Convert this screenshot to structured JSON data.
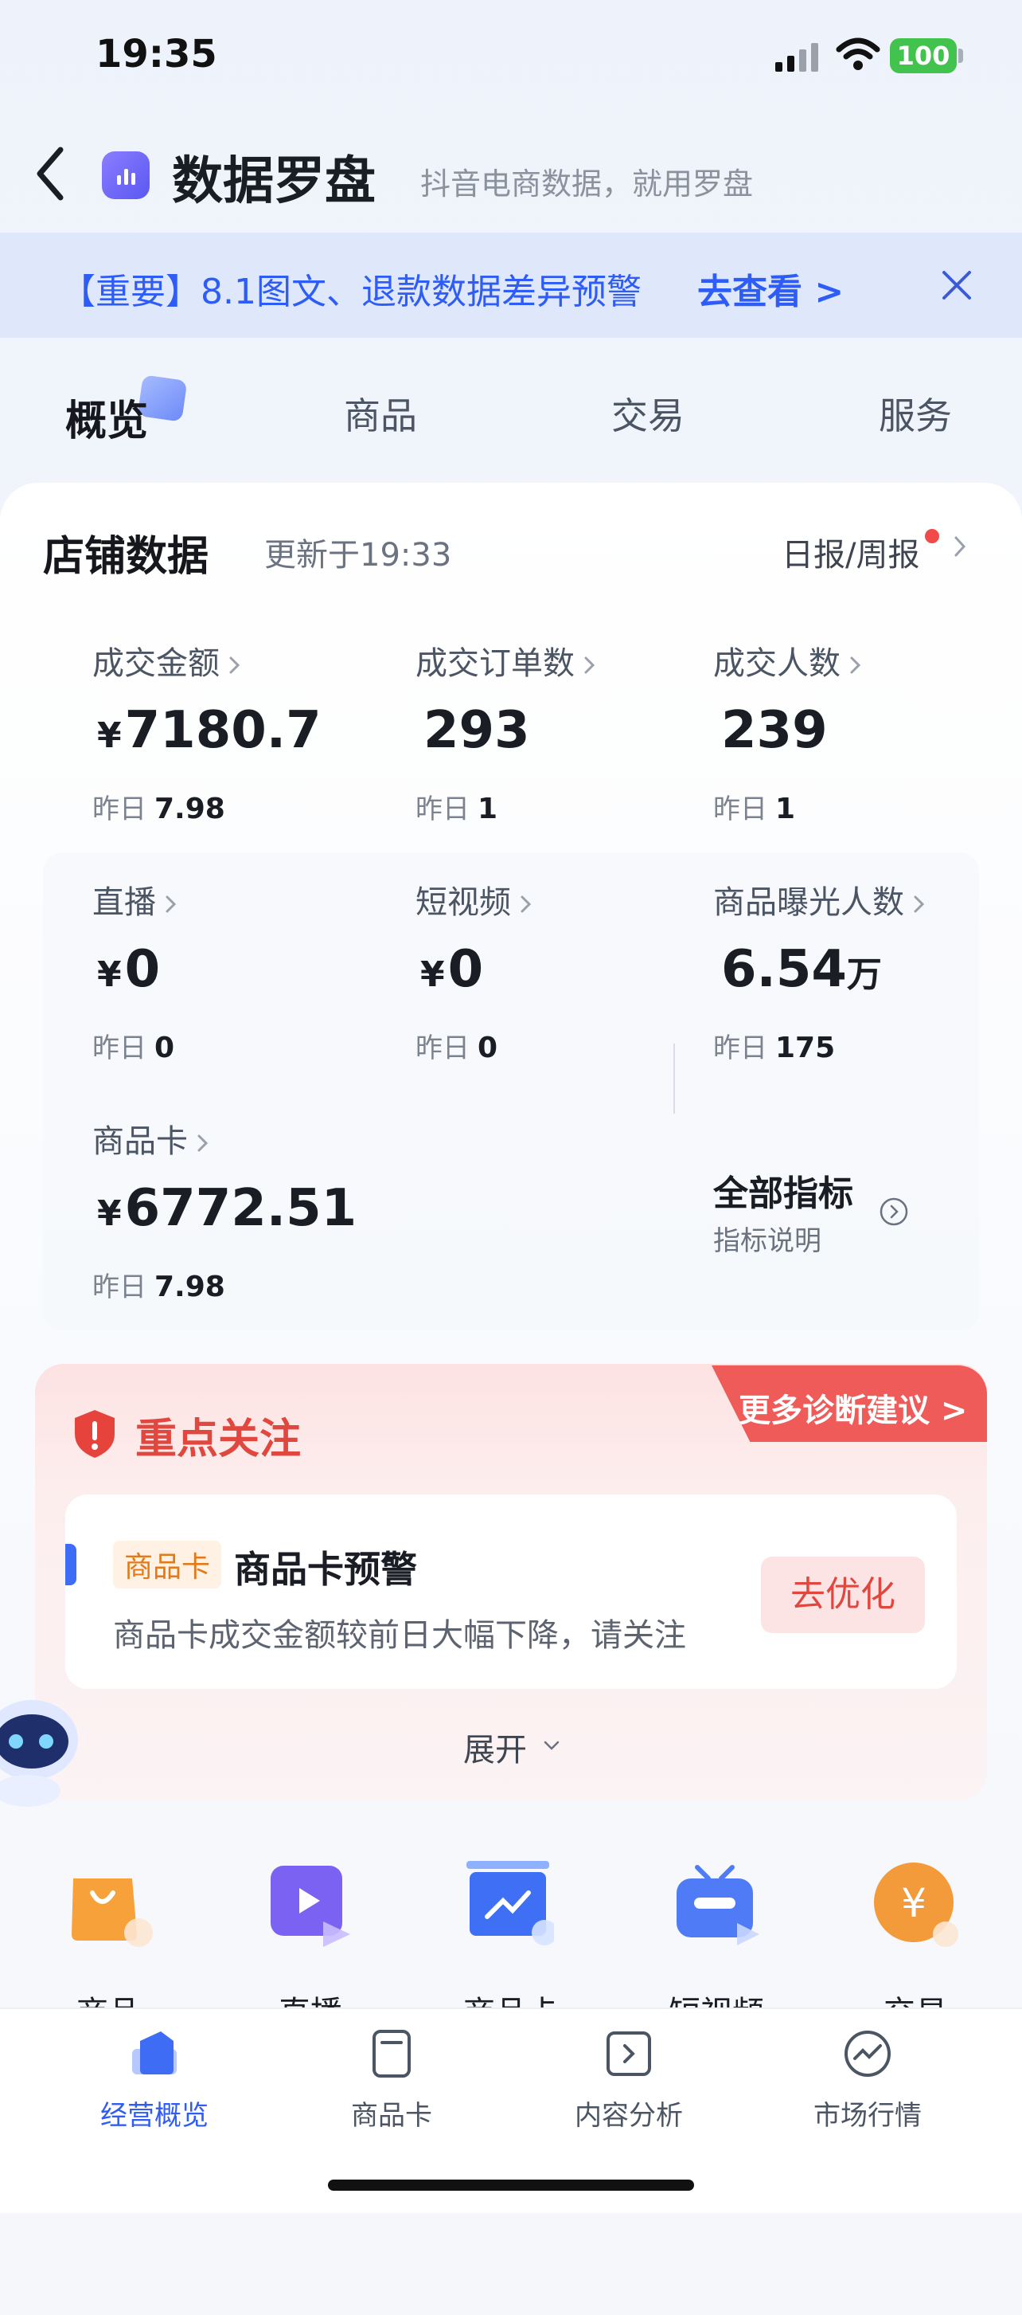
{
  "status_bar": {
    "time": "19:35",
    "battery": "100"
  },
  "header": {
    "title": "数据罗盘",
    "subtitle": "抖音电商数据，就用罗盘"
  },
  "notice": {
    "text": "【重要】8.1图文、退款数据差异预警",
    "link": "去查看 >"
  },
  "tabs": [
    "概览",
    "商品",
    "交易",
    "服务"
  ],
  "store": {
    "title": "店铺数据",
    "updated": "更新于19:33",
    "report": "日报/周报",
    "prev_label": "昨日",
    "metrics": [
      {
        "label": "成交金额",
        "currency": "¥",
        "value": "7180.7",
        "unit": "",
        "prev": "7.98"
      },
      {
        "label": "成交订单数",
        "currency": "",
        "value": "293",
        "unit": "",
        "prev": "1"
      },
      {
        "label": "成交人数",
        "currency": "",
        "value": "239",
        "unit": "",
        "prev": "1"
      },
      {
        "label": "直播",
        "currency": "¥",
        "value": "0",
        "unit": "",
        "prev": "0"
      },
      {
        "label": "短视频",
        "currency": "¥",
        "value": "0",
        "unit": "",
        "prev": "0"
      },
      {
        "label": "商品曝光人数",
        "currency": "",
        "value": "6.54",
        "unit": "万",
        "prev": "175"
      },
      {
        "label": "商品卡",
        "currency": "¥",
        "value": "6772.51",
        "unit": "",
        "prev": "7.98"
      }
    ],
    "all_metrics": "全部指标",
    "metric_explain": "指标说明"
  },
  "focus": {
    "title": "重点关注",
    "diag_link": "更多诊断建议 >",
    "alert_tag": "商品卡",
    "alert_title": "商品卡预警",
    "alert_desc": "商品卡成交金额较前日大幅下降，请关注",
    "action": "去优化",
    "expand": "展开"
  },
  "shortcuts": [
    "商品",
    "直播",
    "商品卡",
    "短视频",
    "交易"
  ],
  "bottom_nav": [
    "经营概览",
    "商品卡",
    "内容分析",
    "市场行情"
  ],
  "colors": {
    "accent": "#2f5cf5",
    "alert_red": "#e0483f",
    "notice_bg": "#dfe7fb"
  }
}
